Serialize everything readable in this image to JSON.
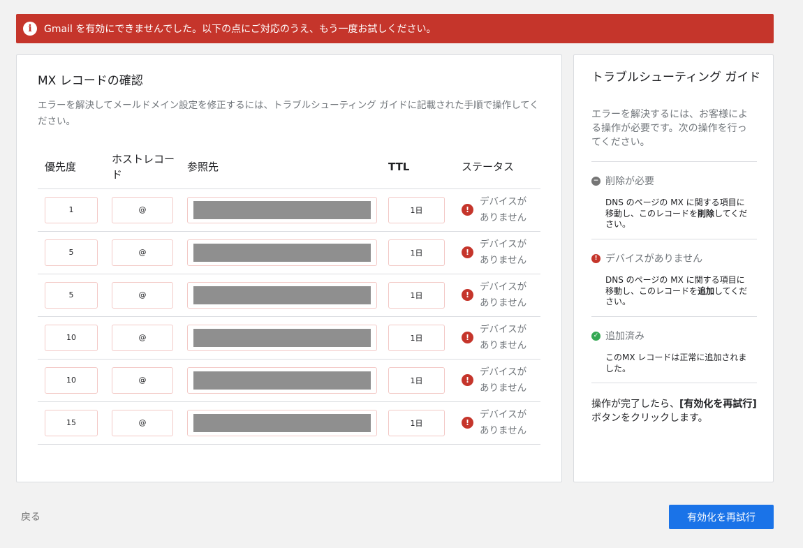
{
  "banner": {
    "icon": "info-icon",
    "message": "Gmail を有効にできませんでした。以下の点にご対応のうえ、もう一度お試しください。"
  },
  "main": {
    "title": "MX レコードの確認",
    "description": "エラーを解決してメールドメイン設定を修正するには、トラブルシューティング ガイドに記載された手順で操作してください。",
    "columns": [
      "優先度",
      "ホストレコード",
      "参照先",
      "TTL",
      "ステータス"
    ],
    "rows": [
      {
        "priority": "1",
        "host": "@",
        "ttl": "1日",
        "status": "デバイスがありません"
      },
      {
        "priority": "5",
        "host": "@",
        "ttl": "1日",
        "status": "デバイスがありません"
      },
      {
        "priority": "5",
        "host": "@",
        "ttl": "1日",
        "status": "デバイスがありません"
      },
      {
        "priority": "10",
        "host": "@",
        "ttl": "1日",
        "status": "デバイスがありません"
      },
      {
        "priority": "10",
        "host": "@",
        "ttl": "1日",
        "status": "デバイスがありません"
      },
      {
        "priority": "15",
        "host": "@",
        "ttl": "1日",
        "status": "デバイスがありません"
      }
    ]
  },
  "guide": {
    "title": "トラブルシューティング ガイド",
    "description": "エラーを解決するには、お客様による操作が必要です。次の操作を行ってください。",
    "items": [
      {
        "icon": "minus-circle-icon",
        "heading": "削除が必要",
        "body_pre": "DNS のページの MX に関する項目に移動し、このレコードを",
        "body_bold": "削除",
        "body_post": "してください。"
      },
      {
        "icon": "error-icon",
        "heading": "デバイスがありません",
        "body_pre": "DNS のページの MX に関する項目に移動し、このレコードを",
        "body_bold": "追加",
        "body_post": "してください。"
      },
      {
        "icon": "check-circle-icon",
        "heading": "追加済み",
        "body_pre": "このMX レコードは正常に追加されました。",
        "body_bold": "",
        "body_post": ""
      }
    ],
    "footer_pre": "操作が完了したら、",
    "footer_bold": "[有効化を再試行]",
    "footer_post": " ボタンをクリックします。"
  },
  "footer": {
    "back_label": "戻る",
    "retry_label": "有効化を再試行"
  },
  "colors": {
    "error": "#c5352b",
    "primary": "#1a73e8",
    "success": "#34a853"
  }
}
